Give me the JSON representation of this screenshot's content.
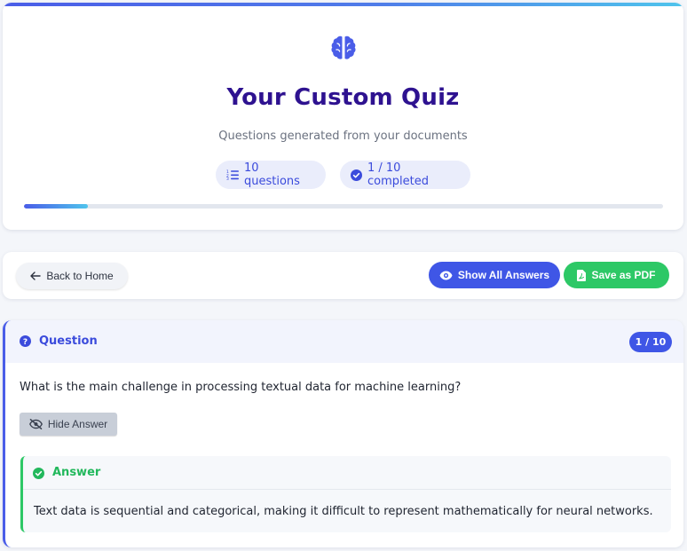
{
  "header": {
    "title": "Your Custom Quiz",
    "subtitle": "Questions generated from your documents",
    "questions_badge": "10 questions",
    "completed_badge": "1 / 10 completed",
    "progress_fraction": 0.1
  },
  "toolbar": {
    "back_label": "Back to Home",
    "show_answers_label": "Show All Answers",
    "save_pdf_label": "Save as PDF"
  },
  "question": {
    "label": "Question",
    "counter": "1 / 10",
    "text": "What is the main challenge in processing textual data for machine learning?",
    "hide_answer_label": "Hide Answer"
  },
  "answer": {
    "label": "Answer",
    "text": "Text data is sequential and categorical, making it difficult to represent mathematically for neural networks."
  },
  "colors": {
    "accent": "#3f56e6",
    "title": "#2e1290",
    "success": "#2dc866"
  },
  "icons": {
    "header": "brain-icon",
    "questions_badge": "list-ordered-icon",
    "completed_badge": "check-circle-icon",
    "back": "arrow-left-icon",
    "show_answers": "eye-icon",
    "save_pdf": "file-pdf-icon",
    "question": "question-circle-icon",
    "hide_answer": "eye-slash-icon",
    "answer": "check-circle-icon"
  }
}
